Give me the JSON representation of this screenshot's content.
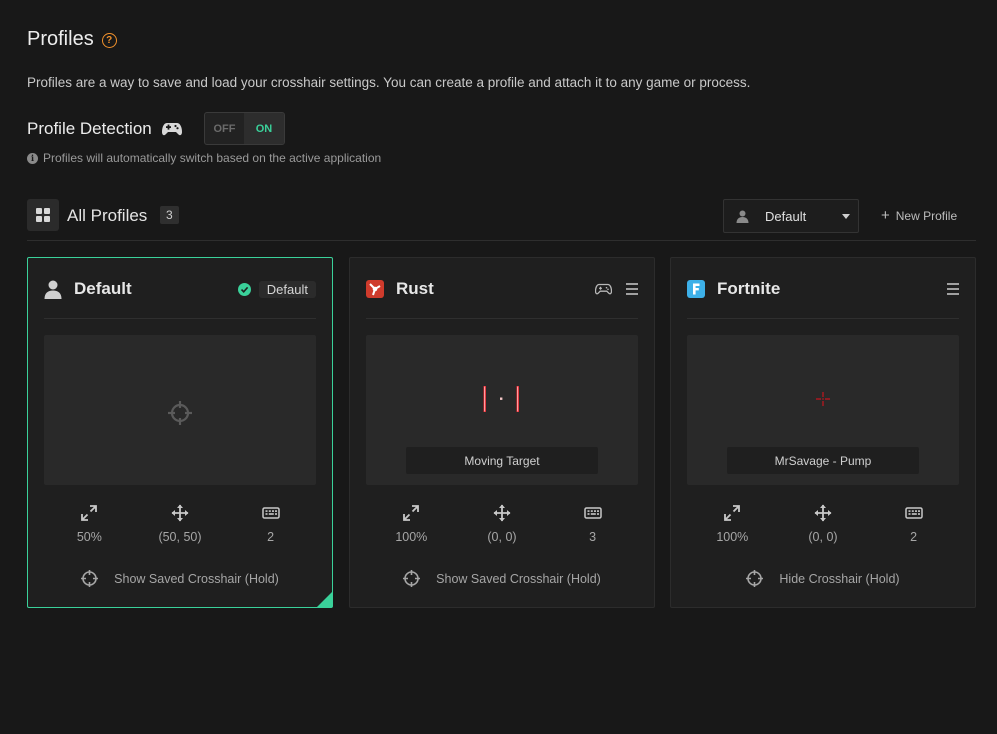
{
  "page": {
    "title": "Profiles",
    "description": "Profiles are a way to save and load your crosshair settings. You can create a profile and attach it to any game or process.",
    "detection_label": "Profile Detection",
    "toggle_off": "OFF",
    "toggle_on": "ON",
    "toggle_state": "on",
    "hint": "Profiles will automatically switch based on the active application"
  },
  "section": {
    "title": "All Profiles",
    "count": "3",
    "select_value": "Default",
    "new_profile_label": "New Profile"
  },
  "colors": {
    "accent": "#3ad19a",
    "help": "#f0912c",
    "rust": "#cf3b2c",
    "fortnite": "#3db0e8",
    "crosshair_red": "#e0242c"
  },
  "profiles": [
    {
      "name": "Default",
      "icon": "user-icon",
      "badge": "Default",
      "preview_label": "",
      "scale": "50%",
      "position": "(50, 50)",
      "keys": "2",
      "hotkey": "Show Saved Crosshair (Hold)"
    },
    {
      "name": "Rust",
      "icon": "rust-logo-icon",
      "badge": "",
      "preview_label": "Moving Target",
      "scale": "100%",
      "position": "(0, 0)",
      "keys": "3",
      "hotkey": "Show Saved Crosshair (Hold)"
    },
    {
      "name": "Fortnite",
      "icon": "fortnite-logo-icon",
      "badge": "",
      "preview_label": "MrSavage - Pump",
      "scale": "100%",
      "position": "(0, 0)",
      "keys": "2",
      "hotkey": "Hide Crosshair (Hold)"
    }
  ]
}
